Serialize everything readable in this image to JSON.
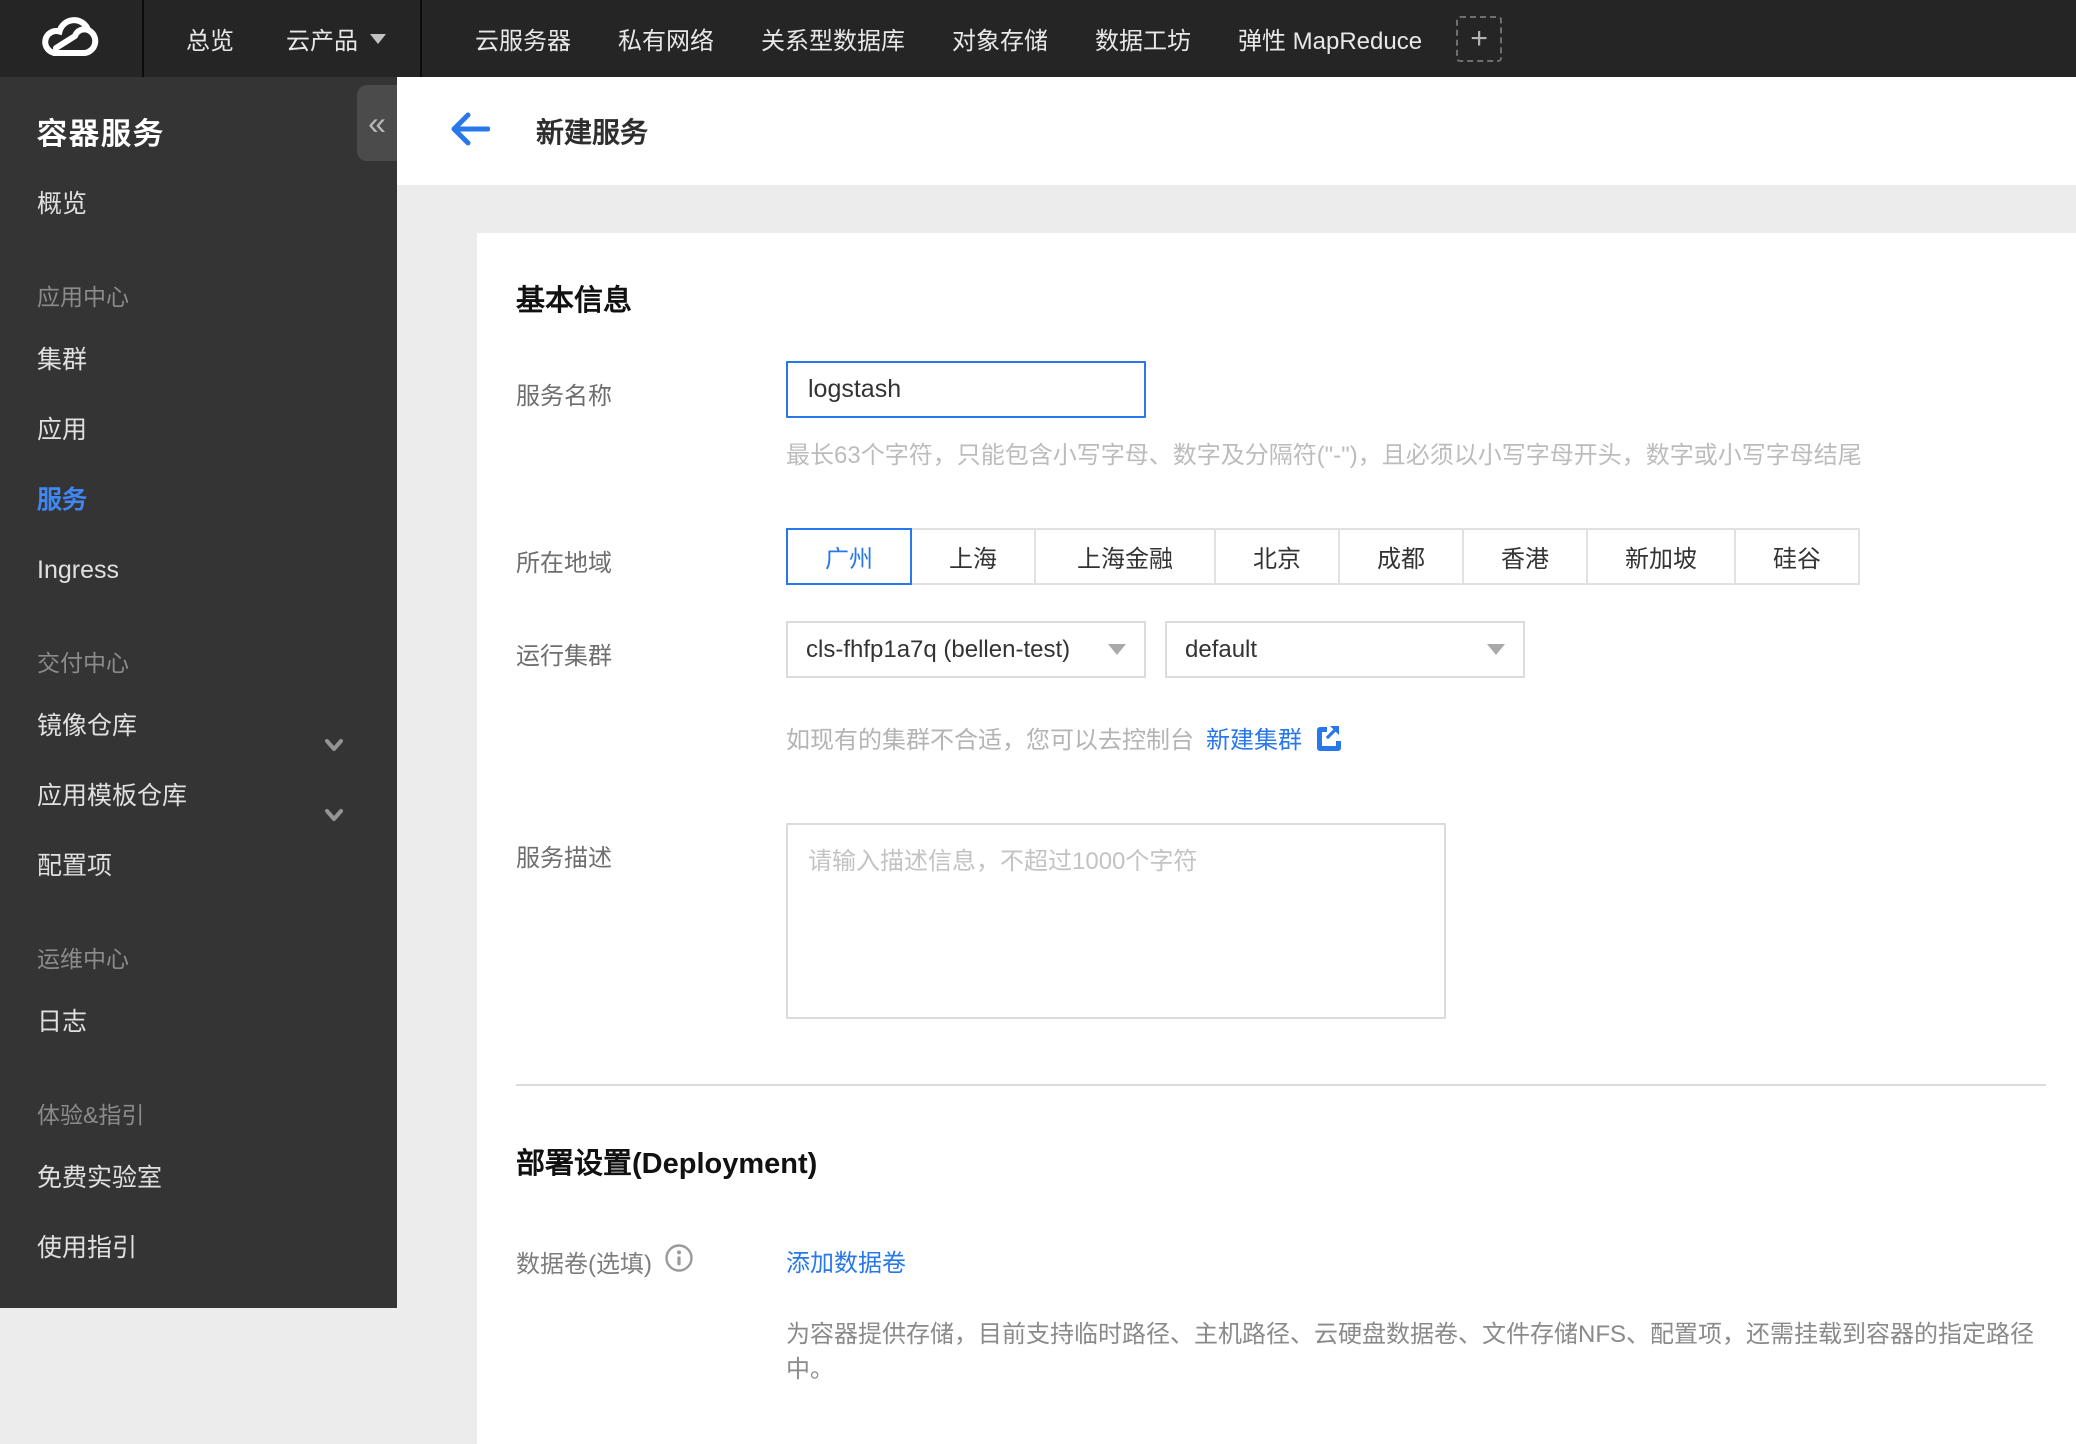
{
  "nav": {
    "logo": "tencent-cloud-logo",
    "overview": "总览",
    "products_menu": "云产品",
    "items": [
      "云服务器",
      "私有网络",
      "关系型数据库",
      "对象存储",
      "数据工坊",
      "弹性 MapReduce"
    ],
    "add_label": "+"
  },
  "sidebar": {
    "title": "容器服务",
    "collapse": "«",
    "items": [
      {
        "label": "概览",
        "type": "link"
      },
      {
        "label": "应用中心",
        "type": "section"
      },
      {
        "label": "集群",
        "type": "link"
      },
      {
        "label": "应用",
        "type": "link"
      },
      {
        "label": "服务",
        "type": "link",
        "active": true
      },
      {
        "label": "Ingress",
        "type": "link"
      },
      {
        "label": "交付中心",
        "type": "section"
      },
      {
        "label": "镜像仓库",
        "type": "link",
        "expandable": true
      },
      {
        "label": "应用模板仓库",
        "type": "link",
        "expandable": true
      },
      {
        "label": "配置项",
        "type": "link"
      },
      {
        "label": "运维中心",
        "type": "section"
      },
      {
        "label": "日志",
        "type": "link"
      },
      {
        "label": "体验&指引",
        "type": "section"
      },
      {
        "label": "免费实验室",
        "type": "link"
      },
      {
        "label": "使用指引",
        "type": "link"
      }
    ]
  },
  "header": {
    "title": "新建服务"
  },
  "form": {
    "basic": {
      "section_title": "基本信息",
      "name": {
        "label": "服务名称",
        "value": "logstash",
        "hint": "最长63个字符，只能包含小写字母、数字及分隔符(\"-\")，且必须以小写字母开头，数字或小写字母结尾"
      },
      "region": {
        "label": "所在地域",
        "options": [
          "广州",
          "上海",
          "上海金融",
          "北京",
          "成都",
          "香港",
          "新加坡",
          "硅谷"
        ],
        "selected": "广州"
      },
      "cluster": {
        "label": "运行集群",
        "cluster_value": "cls-fhfp1a7q (bellen-test)",
        "namespace_value": "default",
        "hint_prefix": "如现有的集群不合适，您可以去控制台",
        "link": "新建集群"
      },
      "description": {
        "label": "服务描述",
        "placeholder": "请输入描述信息，不超过1000个字符"
      }
    },
    "deployment": {
      "section_title": "部署设置(Deployment)",
      "volume": {
        "label": "数据卷(选填)",
        "add_link": "添加数据卷",
        "help": "为容器提供存储，目前支持临时路径、主机路径、云硬盘数据卷、文件存储NFS、配置项，还需挂载到容器的指定路径中。"
      }
    }
  },
  "colors": {
    "accent": "#2878ec",
    "sidebar_active": "#3f87f5",
    "nav_bg": "#252525",
    "sidebar_bg": "#343434",
    "page_bg": "#ececec",
    "card_bg": "#ffffff"
  }
}
